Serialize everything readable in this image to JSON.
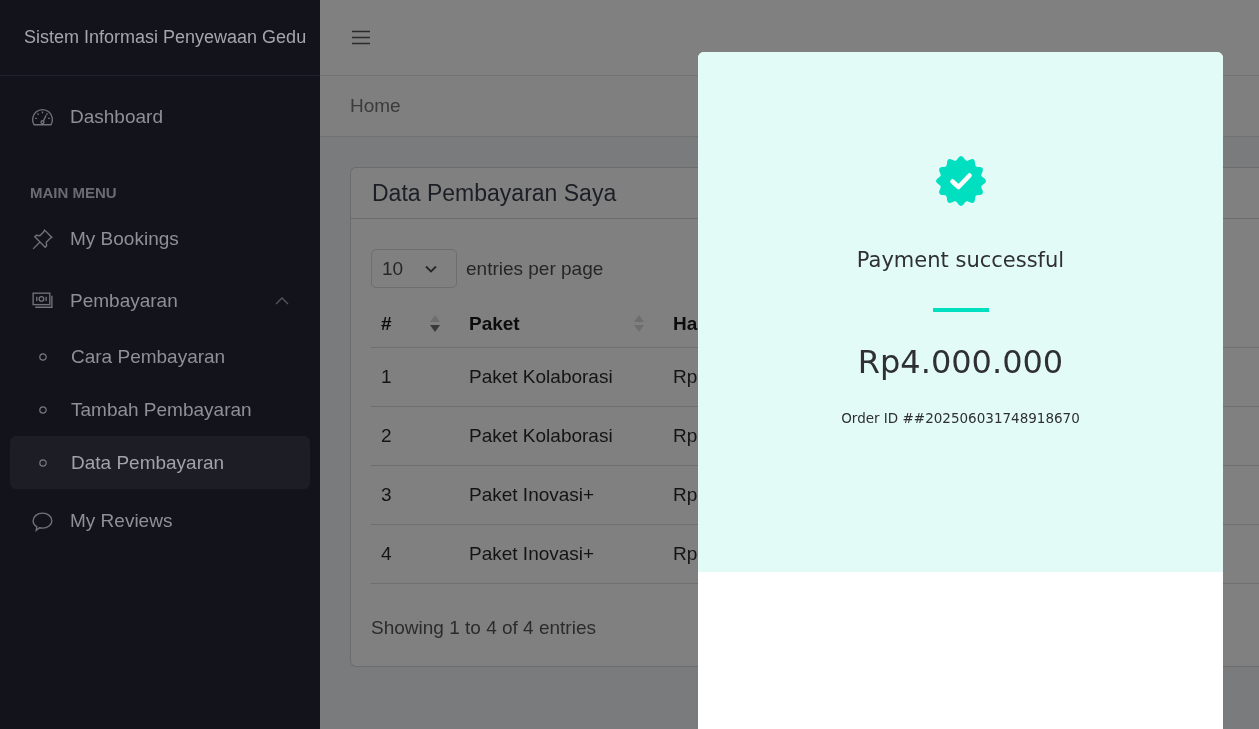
{
  "sidebar": {
    "brand": "Sistem Informasi Penyewaan Gedu",
    "items": [
      {
        "kind": "link",
        "label": "Dashboard",
        "selected": false
      },
      {
        "kind": "heading",
        "label": "MAIN MENU"
      },
      {
        "kind": "link",
        "label": "My Bookings",
        "selected": false
      },
      {
        "kind": "group",
        "label": "Pembayaran",
        "selected": false,
        "expanded": true,
        "children": [
          {
            "label": "Cara Pembayaran",
            "selected": false
          },
          {
            "label": "Tambah Pembayaran",
            "selected": false
          },
          {
            "label": "Data Pembayaran",
            "selected": true
          }
        ]
      },
      {
        "kind": "link",
        "label": "My Reviews",
        "selected": false
      }
    ]
  },
  "breadcrumb": [
    "Home"
  ],
  "card": {
    "title": "Data Pembayaran Saya",
    "page_size": {
      "value": "10"
    },
    "page_size_label": "entries per page",
    "table": {
      "columns": [
        {
          "label": "#",
          "sorted": true,
          "descending": true
        },
        {
          "label": "Paket",
          "sorted": false
        },
        {
          "label": "Ha"
        }
      ],
      "rows": [
        [
          "1",
          "Paket Kolaborasi",
          "Rp"
        ],
        [
          "2",
          "Paket Kolaborasi",
          "Rp"
        ],
        [
          "3",
          "Paket Inovasi+",
          "Rp"
        ],
        [
          "4",
          "Paket Inovasi+",
          "Rp"
        ]
      ]
    },
    "info": "Showing 1 to 4 of 4 entries"
  },
  "modal": {
    "title": "Payment successful",
    "amount": "Rp4.000.000",
    "order_id": "Order ID ##202506031748918670"
  }
}
